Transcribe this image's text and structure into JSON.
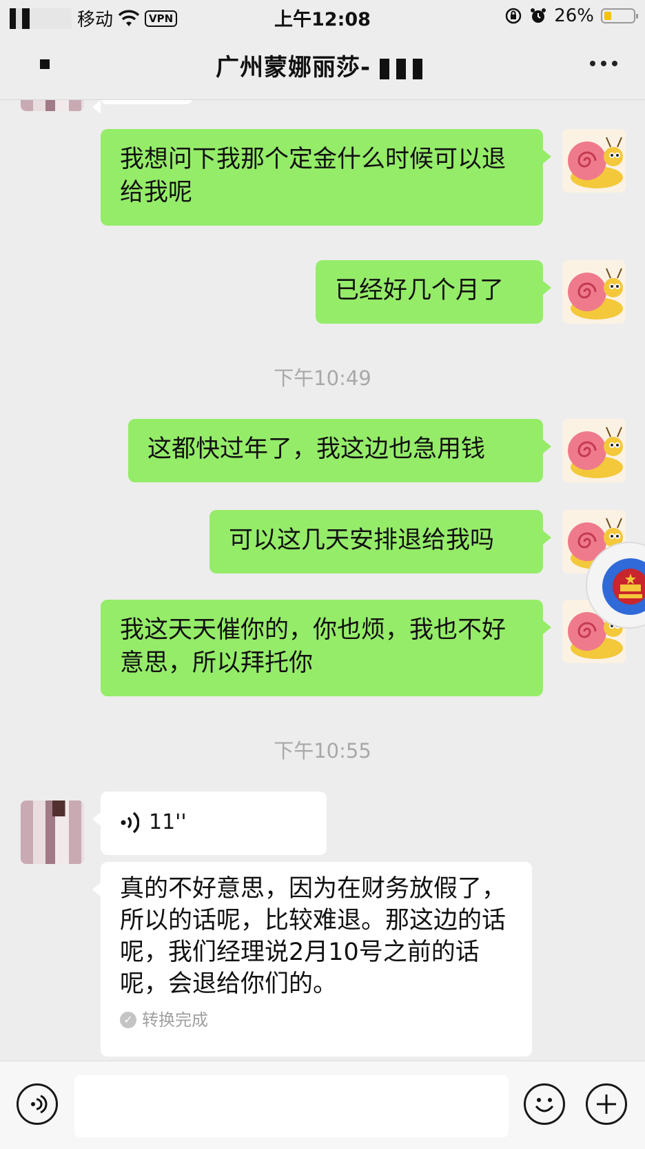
{
  "status_bar": {
    "carrier": "移动",
    "vpn_label": "VPN",
    "time": "上午12:08",
    "battery_percent_label": "26%",
    "battery_level": 0.26,
    "icons": [
      "signal-icon",
      "wifi-icon",
      "vpn-icon",
      "rotation-lock-icon",
      "alarm-icon",
      "battery-icon"
    ]
  },
  "nav": {
    "title": "广州蒙娜丽莎-",
    "icons": [
      "back-icon",
      "more-icon"
    ]
  },
  "messages": [
    {
      "side": "out",
      "text": "我想问下我那个定金什么时候可以退给我呢"
    },
    {
      "side": "out",
      "text": "已经好几个月了"
    },
    {
      "type": "timestamp",
      "text": "下午10:49"
    },
    {
      "side": "out",
      "text": "这都快过年了，我这边也急用钱"
    },
    {
      "side": "out",
      "text": "可以这几天安排退给我吗"
    },
    {
      "side": "out",
      "text": "我这天天催你的，你也烦，我也不好意思，所以拜托你"
    },
    {
      "type": "timestamp",
      "text": "下午10:55"
    },
    {
      "side": "in",
      "type": "voice",
      "duration": "11''"
    },
    {
      "side": "in",
      "type": "transcript",
      "text": "真的不好意思，因为在财务放假了，所以的话呢，比较难退。那这边的话呢，我们经理说2月10号之前的话呢，会退给你们的。",
      "status": "转换完成"
    }
  ],
  "colors": {
    "background": "#ededed",
    "outgoing_bubble": "#95ec69",
    "incoming_bubble": "#ffffff",
    "timestamp_text": "#a8a8a8"
  }
}
